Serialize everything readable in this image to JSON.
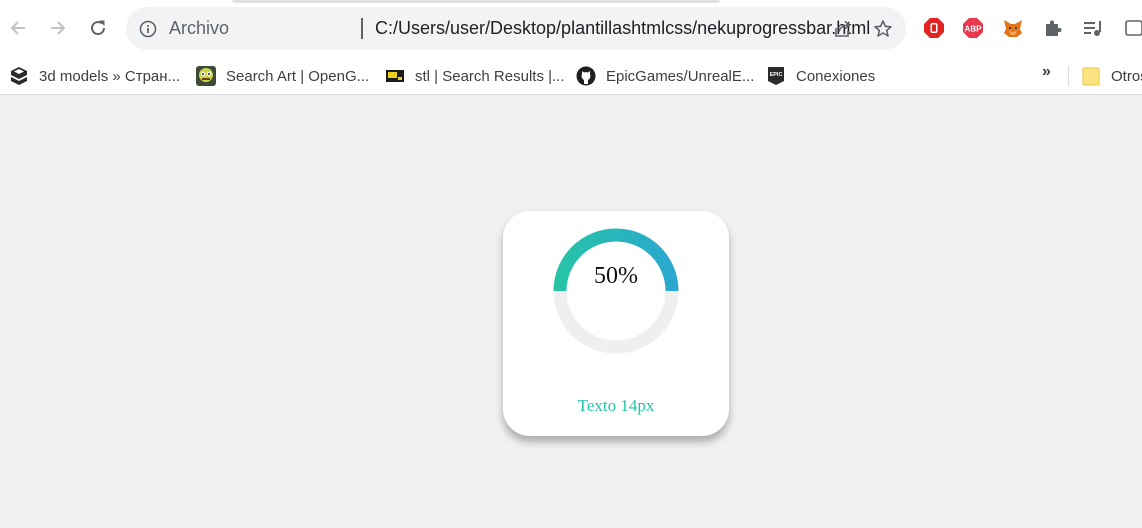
{
  "browser": {
    "back_icon": "arrow-left-icon",
    "forward_icon": "arrow-right-icon",
    "reload_icon": "reload-icon",
    "address": {
      "security_label": "Archivo",
      "url": "C:/Users/user/Desktop/plantillashtmlcss/nekuprogressbar.html"
    },
    "extensions": [
      "stop-ext-icon",
      "abp-icon",
      "fox-icon",
      "puzzle-icon",
      "media-queue-icon"
    ],
    "abp_text": "ABP"
  },
  "bookmarks": {
    "items": [
      {
        "label": "3d models » Стран...",
        "icon": "cubes-icon"
      },
      {
        "label": "Search Art | OpenG...",
        "icon": "opengameart-icon"
      },
      {
        "label": "stl | Search Results |...",
        "icon": "thingiverse-icon"
      },
      {
        "label": "EpicGames/UnrealE...",
        "icon": "github-icon"
      },
      {
        "label": "Conexiones",
        "icon": "epic-games-icon"
      }
    ],
    "epic_text": "EPIC",
    "overflow_label": "»",
    "other_label": "Otros"
  },
  "card": {
    "progress_percent": 50,
    "value_text": "50%",
    "caption": "Texto 14px",
    "colors": {
      "arc_start": "#26c3a8",
      "arc_end": "#2aa8cf",
      "track": "#efefef",
      "caption": "#26c3a8"
    }
  }
}
